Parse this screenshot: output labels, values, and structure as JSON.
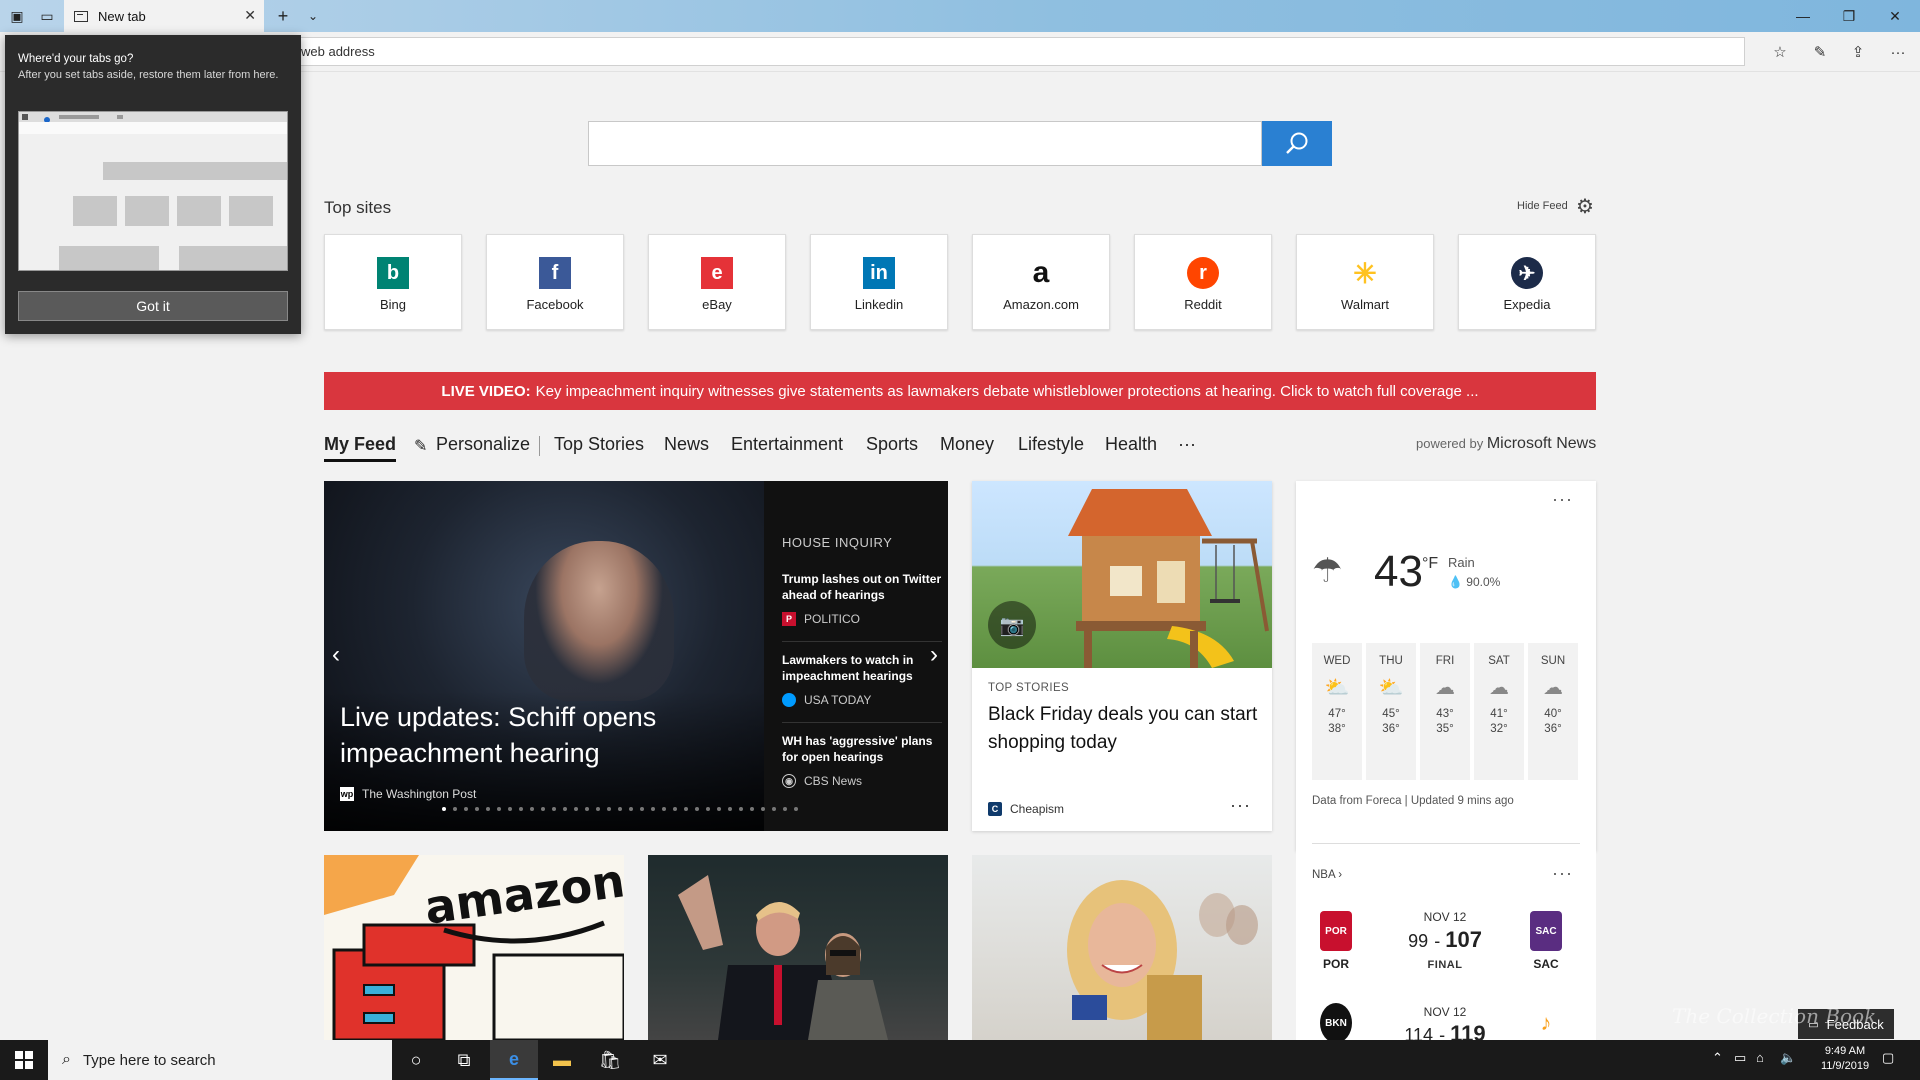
{
  "browser": {
    "tab_title": "New tab",
    "address_placeholder": "Search or enter web address",
    "address_visible": "web address"
  },
  "popup": {
    "title": "Where'd your tabs go?",
    "text": "After you set tabs aside, restore them later from here.",
    "button": "Got it"
  },
  "top_sites": {
    "label": "Top sites",
    "hide_feed": "Hide Feed",
    "sites": [
      {
        "label": "Bing",
        "color": "#008373",
        "glyph": "b"
      },
      {
        "label": "Facebook",
        "color": "#3b5998",
        "glyph": "f"
      },
      {
        "label": "eBay",
        "color": "#e53238",
        "glyph": "e"
      },
      {
        "label": "Linkedin",
        "color": "#0077b5",
        "glyph": "in"
      },
      {
        "label": "Amazon.com",
        "color": "#111111",
        "glyph": "a"
      },
      {
        "label": "Reddit",
        "color": "#ff4500",
        "glyph": "r"
      },
      {
        "label": "Walmart",
        "color": "#ffc220",
        "glyph": "✳"
      },
      {
        "label": "Expedia",
        "color": "#1c2b49",
        "glyph": "✈"
      }
    ]
  },
  "banner": {
    "prefix": "LIVE VIDEO:",
    "text": "Key impeachment inquiry witnesses give statements as lawmakers debate whistleblower protections at hearing. Click to watch full coverage ..."
  },
  "feed_nav": {
    "items": [
      "My Feed",
      "Personalize",
      "Top Stories",
      "News",
      "Entertainment",
      "Sports",
      "Money",
      "Lifestyle",
      "Health",
      "···"
    ],
    "powered_prefix": "powered by",
    "powered_brand": "Microsoft News"
  },
  "hero": {
    "title": "Live updates: Schiff opens impeachment hearing",
    "source": "The Washington Post",
    "side_heading": "HOUSE INQUIRY",
    "side_items": [
      {
        "title": "Trump lashes out on Twitter ahead of hearings",
        "source": "POLITICO"
      },
      {
        "title": "Lawmakers to watch in impeachment hearings",
        "source": "USA TODAY"
      },
      {
        "title": "WH has 'aggressive' plans for open hearings",
        "source": "CBS News"
      }
    ]
  },
  "card2": {
    "category": "TOP STORIES",
    "title": "Black Friday deals you can start shopping today",
    "source": "Cheapism"
  },
  "weather": {
    "temp": "43",
    "unit": "°F",
    "condition": "Rain",
    "precip": "90.0%",
    "days": [
      {
        "name": "WED",
        "hi": "47°",
        "lo": "38°",
        "icon": "partly-sunny"
      },
      {
        "name": "THU",
        "hi": "45°",
        "lo": "36°",
        "icon": "partly-sunny"
      },
      {
        "name": "FRI",
        "hi": "43°",
        "lo": "35°",
        "icon": "cloudy"
      },
      {
        "name": "SAT",
        "hi": "41°",
        "lo": "32°",
        "icon": "cloudy"
      },
      {
        "name": "SUN",
        "hi": "40°",
        "lo": "36°",
        "icon": "cloudy"
      }
    ],
    "footer": "Data from Foreca | Updated 9 mins ago"
  },
  "nba": {
    "label": "NBA",
    "games": [
      {
        "date": "NOV 12",
        "away": "POR",
        "home": "SAC",
        "away_score": "99",
        "home_score": "107",
        "status": "FINAL"
      },
      {
        "date": "NOV 12",
        "away": "BKN",
        "home": "UTA",
        "away_score": "114",
        "home_score": "119",
        "status": ""
      }
    ]
  },
  "lower": {
    "amazon_text": "amazon"
  },
  "feedback": "Feedback",
  "taskbar": {
    "search_placeholder": "Type here to search",
    "time": "9:49 AM",
    "date": "11/9/2019"
  },
  "watermark": "The Collection Book"
}
